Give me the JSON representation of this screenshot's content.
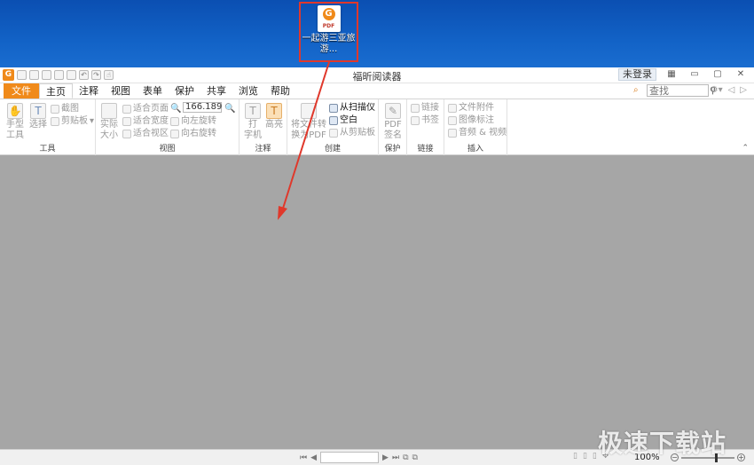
{
  "desktop": {
    "file_icon": {
      "name": "一起游三亚旅游...",
      "badge": "PDF"
    }
  },
  "app": {
    "title": "福昕阅读器",
    "login_label": "未登录",
    "logo_glyph": "G"
  },
  "menu": {
    "tabs": [
      "文件",
      "主页",
      "注释",
      "视图",
      "表单",
      "保护",
      "共享",
      "浏览",
      "帮助"
    ],
    "active": "主页",
    "search_placeholder": "查找"
  },
  "ribbon": {
    "groups": {
      "tools": {
        "label": "工具",
        "hand": "手型\n工具",
        "select": "选择",
        "screenshot": "截图",
        "clipboard": "剪贴板"
      },
      "view": {
        "label": "视图",
        "actual": "实际\n大小",
        "fit_page": "适合页面",
        "fit_width": "适合宽度",
        "fit_view": "适合视区",
        "zoom_value": "166.189",
        "rotate_left": "向左旋转",
        "rotate_right": "向右旋转"
      },
      "annot": {
        "label": "注释",
        "typewriter": "打\n字机",
        "highlight": "高亮"
      },
      "create": {
        "label": "创建",
        "convert": "将文件转\n换为PDF",
        "scanner": "从扫描仪",
        "blank": "空白",
        "from_clipboard": "从剪贴板"
      },
      "protect": {
        "label": "保护",
        "sign": "PDF\n签名"
      },
      "links": {
        "label": "链接",
        "link": "链接",
        "bookmark": "书签"
      },
      "insert": {
        "label": "插入",
        "attachment": "文件附件",
        "image_annot": "图像标注",
        "audio_video": "音频 & 视频"
      }
    }
  },
  "status": {
    "zoom": "100%"
  },
  "watermark": "极速下载站",
  "colors": {
    "accent": "#f08a1a",
    "desktop": "#1262c6",
    "doc_bg": "#a6a6a6",
    "highlight_box": "#e0382b"
  }
}
